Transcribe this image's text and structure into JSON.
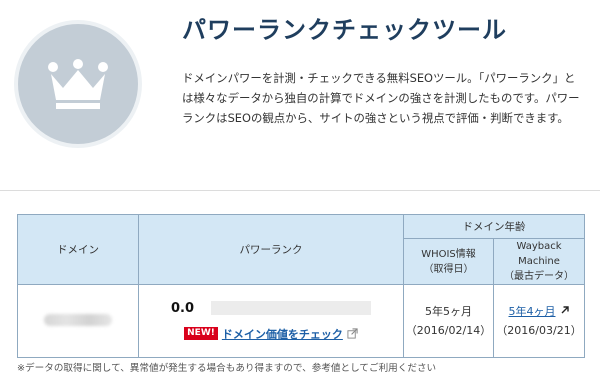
{
  "header": {
    "title": "パワーランクチェックツール",
    "description": "ドメインパワーを計測・チェックできる無料SEOツール。「パワーランク」とは様々なデータから独自の計算でドメインの強さを計測したものです。パワーランクはSEOの観点から、サイトの強さという視点で評価・判断できます。",
    "icon": "crown-icon"
  },
  "table": {
    "headers": {
      "domain": "ドメイン",
      "power_rank": "パワーランク",
      "domain_age": "ドメイン年齢",
      "whois_line1": "WHOIS情報",
      "whois_line2": "（取得日）",
      "wayback_line1": "Wayback Machine",
      "wayback_line2": "（最古データ）"
    },
    "row": {
      "score": "0.0",
      "rank_fill": 0.0,
      "new_badge": "NEW!",
      "check_link": "ドメイン価値をチェック",
      "whois_age": "5年5ヶ月",
      "whois_date": "（2016/02/14）",
      "wayback_age": "5年4ヶ月",
      "wayback_date": "（2016/03/21）"
    }
  },
  "note": "※データの取得に関して、異常値が発生する場合もあり得ますので、参考値としてご利用ください",
  "colors": {
    "title": "#1f3e5e",
    "table_header_bg": "#d3e7f5",
    "link": "#1d5fa6",
    "new_badge": "#d9001b"
  }
}
